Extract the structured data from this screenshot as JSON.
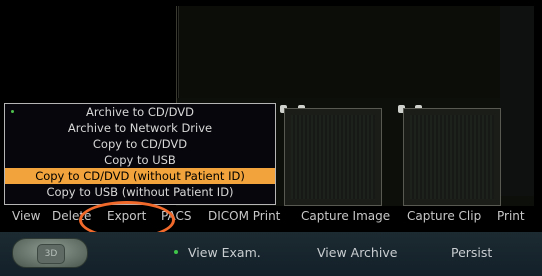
{
  "export_menu": {
    "items": [
      {
        "label": "Archive to CD/DVD",
        "selected": false,
        "bullet": true
      },
      {
        "label": "Archive to Network Drive",
        "selected": false,
        "bullet": false
      },
      {
        "label": "Copy to CD/DVD",
        "selected": false,
        "bullet": false
      },
      {
        "label": "Copy to USB",
        "selected": false,
        "bullet": false
      },
      {
        "label": "Copy to CD/DVD (without Patient ID)",
        "selected": true,
        "bullet": false
      },
      {
        "label": "Copy to USB (without Patient ID)",
        "selected": false,
        "bullet": false
      }
    ]
  },
  "toolbar": {
    "view": "View",
    "delete": "Delete",
    "export": "Export",
    "pacs": "PACS",
    "dicom_print": "DICOM Print",
    "capture_image": "Capture Image",
    "capture_clip": "Capture Clip",
    "print": "Print"
  },
  "bottom_bar": {
    "mode_button": "3D",
    "view_exam": "View Exam.",
    "view_archive": "View Archive",
    "persist": "Persist"
  },
  "colors": {
    "menu_highlight": "#f2a33b",
    "annotation_ring": "#f16a2b",
    "active_dot": "#3fc64a"
  }
}
